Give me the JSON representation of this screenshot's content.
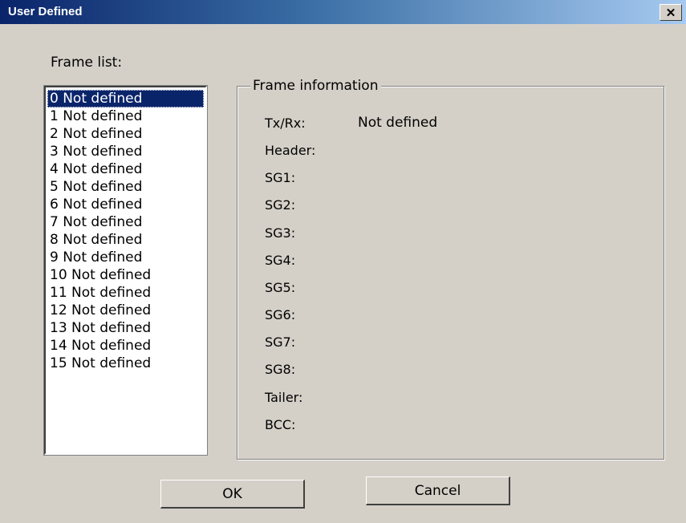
{
  "window": {
    "title": "User Defined",
    "close_icon": "close-icon",
    "close_glyph": "✕"
  },
  "frame_list": {
    "label": "Frame list:",
    "selected_index": 0,
    "items": [
      "0 Not defined",
      "1 Not defined",
      "2 Not defined",
      "3 Not defined",
      "4 Not defined",
      "5 Not defined",
      "6 Not defined",
      "7 Not defined",
      "8 Not defined",
      "9 Not defined",
      "10 Not defined",
      "11 Not defined",
      "12 Not defined",
      "13 Not defined",
      "14 Not defined",
      "15 Not defined"
    ]
  },
  "frame_info": {
    "title": "Frame information",
    "txrx_label": "Tx/Rx:",
    "txrx_value": "Not defined",
    "header_label": "Header:",
    "sg1_label": "SG1:",
    "sg2_label": "SG2:",
    "sg3_label": "SG3:",
    "sg4_label": "SG4:",
    "sg5_label": "SG5:",
    "sg6_label": "SG6:",
    "sg7_label": "SG7:",
    "sg8_label": "SG8:",
    "tailer_label": "Tailer:",
    "bcc_label": "BCC:"
  },
  "buttons": {
    "ok_label": "OK",
    "cancel_label": "Cancel"
  },
  "colors": {
    "selection": "#0a246a",
    "title_gradient_start": "#0a246a",
    "title_gradient_end": "#a6caf0",
    "dialog_bg": "#d4d0c8"
  }
}
